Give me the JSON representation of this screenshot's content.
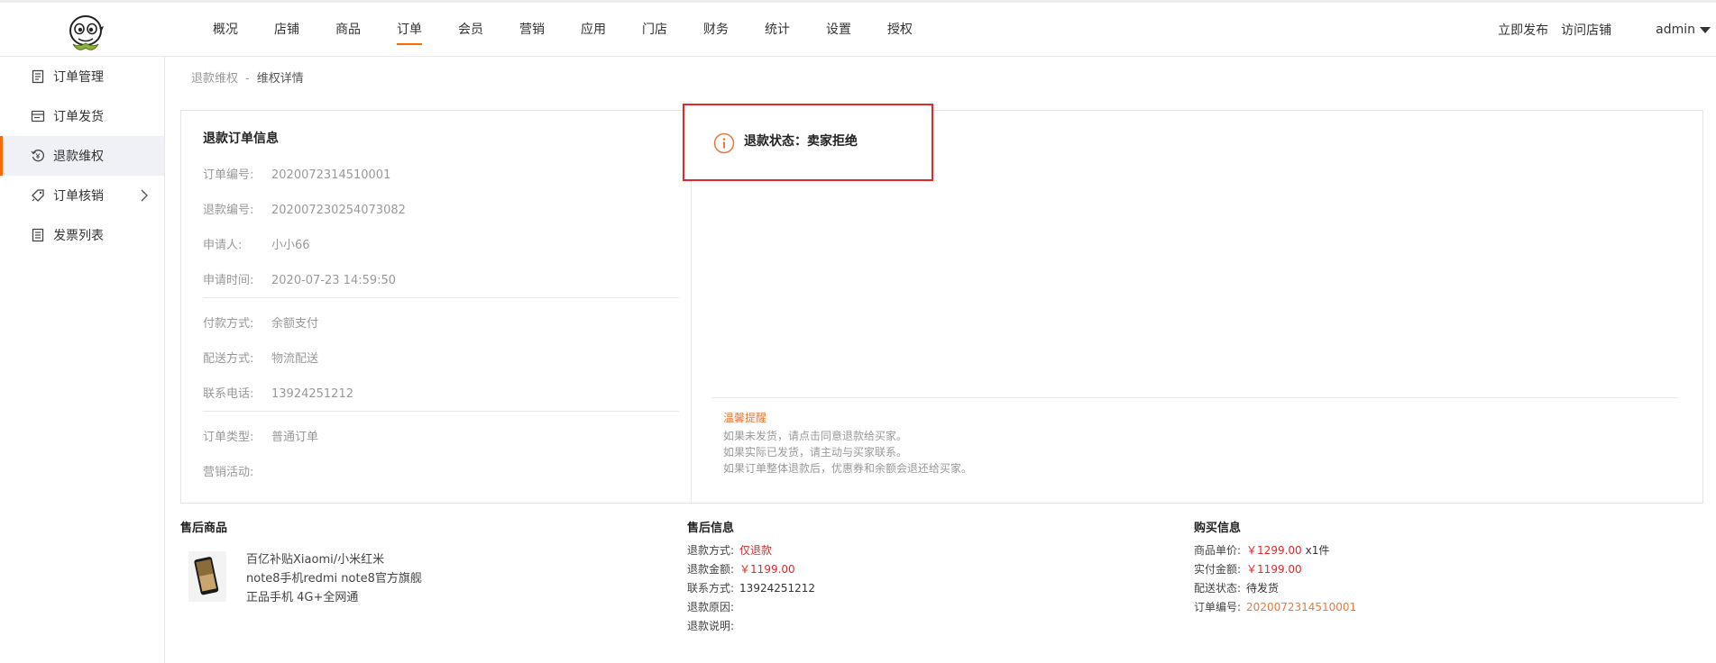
{
  "nav": {
    "items": [
      "概况",
      "店铺",
      "商品",
      "订单",
      "会员",
      "营销",
      "应用",
      "门店",
      "财务",
      "统计",
      "设置",
      "授权"
    ],
    "active_index": 3
  },
  "header_right": {
    "publish": "立即发布",
    "visit": "访问店铺",
    "user": "admin"
  },
  "sidebar": {
    "items": [
      {
        "label": "订单管理",
        "icon": "order-list-icon"
      },
      {
        "label": "订单发货",
        "icon": "truck-icon"
      },
      {
        "label": "退款维权",
        "icon": "refund-icon"
      },
      {
        "label": "订单核销",
        "icon": "verify-tag-icon"
      },
      {
        "label": "发票列表",
        "icon": "invoice-icon"
      }
    ],
    "active_index": 2
  },
  "breadcrumb": {
    "parent": "退款维权",
    "separator": "-",
    "current": "维权详情"
  },
  "refund_order": {
    "title": "退款订单信息",
    "fields": [
      {
        "label": "订单编号:",
        "value": "2020072314510001"
      },
      {
        "label": "退款编号:",
        "value": "202007230254073082"
      },
      {
        "label": "申请人:",
        "value": "小小66"
      },
      {
        "label": "申请时间:",
        "value": "2020-07-23 14:59:50"
      },
      {
        "label": "付款方式:",
        "value": "余额支付"
      },
      {
        "label": "配送方式:",
        "value": "物流配送"
      },
      {
        "label": "联系电话:",
        "value": "13924251212"
      },
      {
        "label": "订单类型:",
        "value": "普通订单"
      },
      {
        "label": "营销活动:",
        "value": ""
      }
    ]
  },
  "status": {
    "text": "退款状态：卖家拒绝",
    "icon": "info-circle-icon",
    "accent": "#e8793a",
    "highlight_border": "#e3282b"
  },
  "tips": {
    "title": "温馨提醒",
    "lines": [
      "如果未发货，请点击同意退款给买家。",
      "如果实际已发货，请主动与买家联系。",
      "如果订单整体退款后，优惠券和余额会退还给买家。"
    ]
  },
  "after_sale_goods": {
    "title": "售后商品",
    "name_lines": [
      "百亿补贴Xiaomi/小米红米",
      "note8手机redmi note8官方旗舰",
      "正品手机 4G+全网通"
    ]
  },
  "after_sale_info": {
    "title": "售后信息",
    "fields": [
      {
        "label": "退款方式:",
        "value": "仅退款"
      },
      {
        "label": "退款金额:",
        "value": "￥1199.00"
      },
      {
        "label": "联系方式:",
        "value": "13924251212"
      },
      {
        "label": "退款原因:",
        "value": ""
      },
      {
        "label": "退款说明:",
        "value": ""
      }
    ]
  },
  "purchase_info": {
    "title": "购买信息",
    "unit_price_label": "商品单价:",
    "unit_price": "￥1299.00",
    "quantity": "x1件",
    "paid_label": "实付金额:",
    "paid": "￥1199.00",
    "delivery_label": "配送状态:",
    "delivery": "待发货",
    "order_no_label": "订单编号:",
    "order_no": "2020072314510001"
  },
  "colors": {
    "brand": "#ff6a00",
    "price_red": "#e3282b",
    "tip_orange": "#e8793a"
  }
}
